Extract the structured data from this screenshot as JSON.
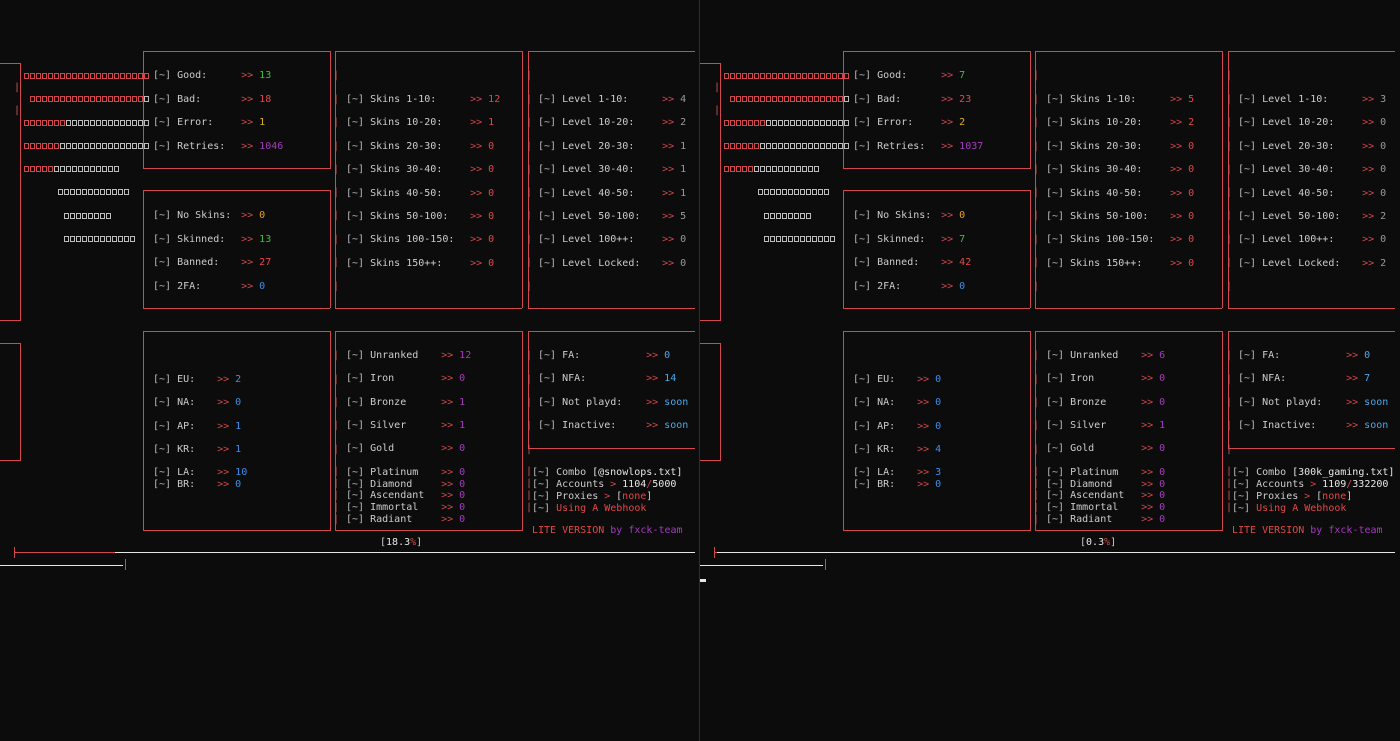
{
  "colors": {
    "background": "#0c0c0c",
    "frame": "#d0474e",
    "label": "#cccccc",
    "good": "#3fbf3f",
    "bad": "#e04848",
    "error": "#d8b226",
    "retries": "#a33bbd",
    "region": "#3f8ee6",
    "rank": "#a33bbd"
  },
  "icons": {
    "logo": "ascii-block-logo",
    "bracket_prefix": "tilde-bracket-icon",
    "arrow": "double-chevron-icon"
  },
  "common": {
    "prefix": "[~]",
    "arrow": ">>",
    "bar": "|"
  },
  "panes": [
    {
      "id": "left",
      "stats": {
        "good": {
          "label": "Good:",
          "value": "13"
        },
        "bad": {
          "label": "Bad:",
          "value": "18"
        },
        "error": {
          "label": "Error:",
          "value": "1"
        },
        "retries": {
          "label": "Retries:",
          "value": "1046"
        },
        "no_skins": {
          "label": "No Skins:",
          "value": "0"
        },
        "skinned": {
          "label": "Skinned:",
          "value": "13"
        },
        "banned": {
          "label": "Banned:",
          "value": "27"
        },
        "twofa": {
          "label": "2FA:",
          "value": "0"
        }
      },
      "skins": [
        {
          "label": "Skins 1-10:",
          "value": "12"
        },
        {
          "label": "Skins 10-20:",
          "value": "1"
        },
        {
          "label": "Skins 20-30:",
          "value": "0"
        },
        {
          "label": "Skins 30-40:",
          "value": "0"
        },
        {
          "label": "Skins 40-50:",
          "value": "0"
        },
        {
          "label": "Skins 50-100:",
          "value": "0"
        },
        {
          "label": "Skins 100-150:",
          "value": "0"
        },
        {
          "label": "Skins 150++:",
          "value": "0"
        }
      ],
      "levels": [
        {
          "label": "Level 1-10:",
          "value": "4"
        },
        {
          "label": "Level 10-20:",
          "value": "2"
        },
        {
          "label": "Level 20-30:",
          "value": "1"
        },
        {
          "label": "Level 30-40:",
          "value": "1"
        },
        {
          "label": "Level 40-50:",
          "value": "1"
        },
        {
          "label": "Level 50-100:",
          "value": "5"
        },
        {
          "label": "Level 100++:",
          "value": "0"
        },
        {
          "label": "Level Locked:",
          "value": "0"
        }
      ],
      "regions": [
        {
          "label": "EU:",
          "value": "2"
        },
        {
          "label": "NA:",
          "value": "0"
        },
        {
          "label": "AP:",
          "value": "1"
        },
        {
          "label": "KR:",
          "value": "1"
        },
        {
          "label": "LA:",
          "value": "10"
        },
        {
          "label": "BR:",
          "value": "0"
        }
      ],
      "ranks": [
        {
          "label": "Unranked",
          "value": "12"
        },
        {
          "label": "Iron",
          "value": "0"
        },
        {
          "label": "Bronze",
          "value": "1"
        },
        {
          "label": "Silver",
          "value": "1"
        },
        {
          "label": "Gold",
          "value": "0"
        },
        {
          "label": "Platinum",
          "value": "0"
        },
        {
          "label": "Diamond",
          "value": "0"
        },
        {
          "label": "Ascendant",
          "value": "0"
        },
        {
          "label": "Immortal",
          "value": "0"
        },
        {
          "label": "Radiant",
          "value": "0"
        }
      ],
      "access": [
        {
          "label": "FA:",
          "value": "0"
        },
        {
          "label": "NFA:",
          "value": "14"
        },
        {
          "label": "Not playd:",
          "value": "soon"
        },
        {
          "label": "Inactive:",
          "value": "soon"
        }
      ],
      "info": {
        "combo_label": "Combo",
        "combo_value": "[@snowlops.txt]",
        "accounts_label": "Accounts",
        "accounts_done": "1104",
        "accounts_sep": "/",
        "accounts_total": "5000",
        "proxies_label": "Proxies",
        "proxies_value": "none",
        "webhook": "Using A Webhook",
        "gt": ">",
        "version_lite": "LITE VERSION",
        "version_by": "by",
        "version_team": "fxck-team"
      },
      "progress": {
        "label": "18.3",
        "percent_sign": "%",
        "fraction": 0.183
      }
    },
    {
      "id": "right",
      "stats": {
        "good": {
          "label": "Good:",
          "value": "7"
        },
        "bad": {
          "label": "Bad:",
          "value": "23"
        },
        "error": {
          "label": "Error:",
          "value": "2"
        },
        "retries": {
          "label": "Retries:",
          "value": "1037"
        },
        "no_skins": {
          "label": "No Skins:",
          "value": "0"
        },
        "skinned": {
          "label": "Skinned:",
          "value": "7"
        },
        "banned": {
          "label": "Banned:",
          "value": "42"
        },
        "twofa": {
          "label": "2FA:",
          "value": "0"
        }
      },
      "skins": [
        {
          "label": "Skins 1-10:",
          "value": "5"
        },
        {
          "label": "Skins 10-20:",
          "value": "2"
        },
        {
          "label": "Skins 20-30:",
          "value": "0"
        },
        {
          "label": "Skins 30-40:",
          "value": "0"
        },
        {
          "label": "Skins 40-50:",
          "value": "0"
        },
        {
          "label": "Skins 50-100:",
          "value": "0"
        },
        {
          "label": "Skins 100-150:",
          "value": "0"
        },
        {
          "label": "Skins 150++:",
          "value": "0"
        }
      ],
      "levels": [
        {
          "label": "Level 1-10:",
          "value": "3"
        },
        {
          "label": "Level 10-20:",
          "value": "0"
        },
        {
          "label": "Level 20-30:",
          "value": "0"
        },
        {
          "label": "Level 30-40:",
          "value": "0"
        },
        {
          "label": "Level 40-50:",
          "value": "0"
        },
        {
          "label": "Level 50-100:",
          "value": "2"
        },
        {
          "label": "Level 100++:",
          "value": "0"
        },
        {
          "label": "Level Locked:",
          "value": "2"
        }
      ],
      "regions": [
        {
          "label": "EU:",
          "value": "0"
        },
        {
          "label": "NA:",
          "value": "0"
        },
        {
          "label": "AP:",
          "value": "0"
        },
        {
          "label": "KR:",
          "value": "4"
        },
        {
          "label": "LA:",
          "value": "3"
        },
        {
          "label": "BR:",
          "value": "0"
        }
      ],
      "ranks": [
        {
          "label": "Unranked",
          "value": "6"
        },
        {
          "label": "Iron",
          "value": "0"
        },
        {
          "label": "Bronze",
          "value": "0"
        },
        {
          "label": "Silver",
          "value": "1"
        },
        {
          "label": "Gold",
          "value": "0"
        },
        {
          "label": "Platinum",
          "value": "0"
        },
        {
          "label": "Diamond",
          "value": "0"
        },
        {
          "label": "Ascendant",
          "value": "0"
        },
        {
          "label": "Immortal",
          "value": "0"
        },
        {
          "label": "Radiant",
          "value": "0"
        }
      ],
      "access": [
        {
          "label": "FA:",
          "value": "0"
        },
        {
          "label": "NFA:",
          "value": "7"
        },
        {
          "label": "Not playd:",
          "value": "soon"
        },
        {
          "label": "Inactive:",
          "value": "soon"
        }
      ],
      "info": {
        "combo_label": "Combo",
        "combo_value": "[300k_gaming.txt]",
        "accounts_label": "Accounts",
        "accounts_done": "1109",
        "accounts_sep": "/",
        "accounts_total": "332200",
        "proxies_label": "Proxies",
        "proxies_value": "none",
        "webhook": "Using A Webhook",
        "gt": ">",
        "version_lite": "LITE VERSION",
        "version_by": "by",
        "version_team": "fxck-team"
      },
      "progress": {
        "label": "0.3",
        "percent_sign": "%",
        "fraction": 0.003
      }
    }
  ]
}
